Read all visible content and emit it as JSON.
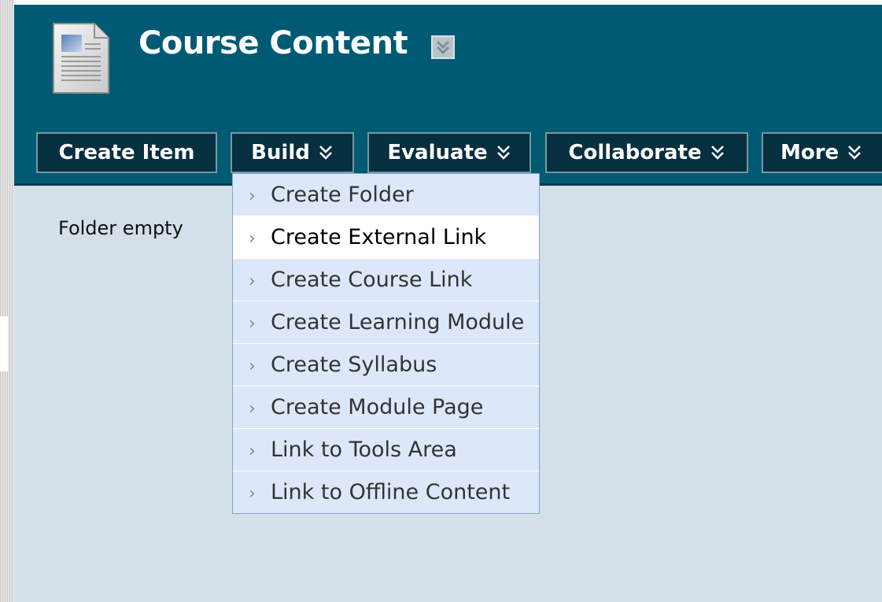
{
  "header": {
    "title": "Course Content"
  },
  "toolbar": {
    "buttons": [
      {
        "label": "Create Item",
        "has_chevron": false
      },
      {
        "label": "Build",
        "has_chevron": true
      },
      {
        "label": "Evaluate",
        "has_chevron": true
      },
      {
        "label": "Collaborate",
        "has_chevron": true
      },
      {
        "label": "More",
        "has_chevron": true
      }
    ]
  },
  "content": {
    "empty_message": "Folder empty"
  },
  "build_menu": {
    "items": [
      {
        "label": "Create Folder"
      },
      {
        "label": "Create External Link",
        "hovered": true
      },
      {
        "label": "Create Course Link"
      },
      {
        "label": "Create Learning Module"
      },
      {
        "label": "Create Syllabus"
      },
      {
        "label": "Create Module Page"
      },
      {
        "label": "Link to Tools Area"
      },
      {
        "label": "Link to Offline Content"
      }
    ],
    "item_arrow": "›"
  },
  "colors": {
    "header_bg": "#005a74",
    "button_bg": "#06303f",
    "content_bg": "#d3e0ea",
    "menu_item_bg": "#dce8fa"
  },
  "icons": {
    "page": "document-icon",
    "chevron": "double-chevron-down-icon"
  }
}
